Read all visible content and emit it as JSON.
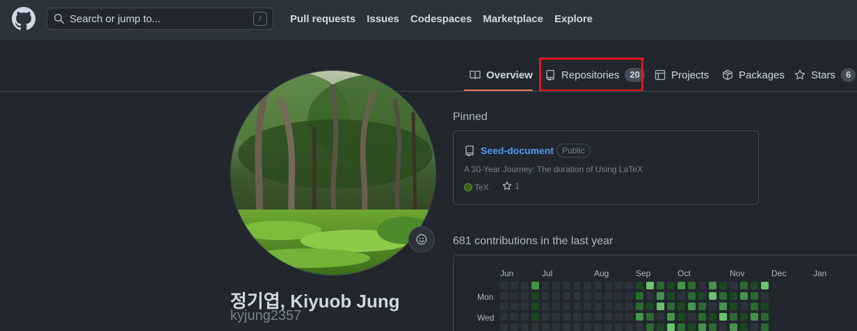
{
  "header": {
    "logo": "github-logo",
    "search_placeholder": "Search or jump to...",
    "search_key": "/",
    "nav": [
      "Pull requests",
      "Issues",
      "Codespaces",
      "Marketplace",
      "Explore"
    ]
  },
  "tabs": {
    "overview": "Overview",
    "repositories": "Repositories",
    "repositories_count": "20",
    "projects": "Projects",
    "packages": "Packages",
    "stars": "Stars",
    "stars_count": "6"
  },
  "profile": {
    "name": "정기엽, Kiyuob Jung",
    "login": "kyjung2357"
  },
  "pinned": {
    "title": "Pinned",
    "repo_name": "Seed-document",
    "visibility": "Public",
    "description": "A 30-Year Journey: The duration of Using LaTeX",
    "language": "TeX",
    "language_color": "#3d6117",
    "stars": "1"
  },
  "contributions": {
    "title": "681 contributions in the last year",
    "months": [
      "Jun",
      "Jul",
      "Aug",
      "Sep",
      "Oct",
      "Nov",
      "Dec",
      "Jan"
    ],
    "day_labels": [
      "Mon",
      "Wed"
    ]
  },
  "colors": {
    "accent": "#ec775c",
    "highlight": "#e5141b",
    "link": "#539bf5"
  }
}
